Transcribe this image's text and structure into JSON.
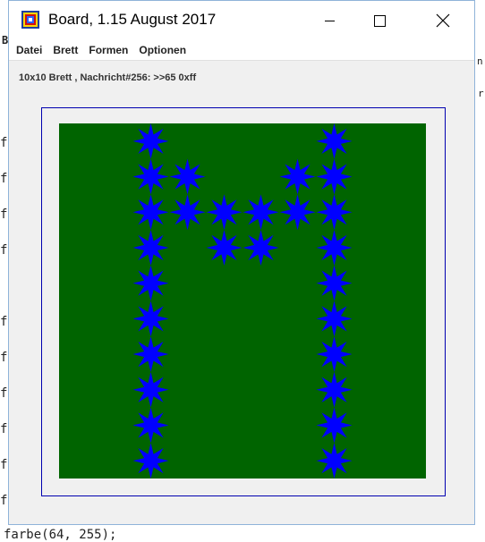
{
  "window": {
    "title": "Board, 1.15 August 2017",
    "minimize_icon": "minimize-icon",
    "maximize_icon": "maximize-icon",
    "close_icon": "close-icon"
  },
  "menu": [
    "Datei",
    "Brett",
    "Formen",
    "Optionen"
  ],
  "status": "10x10 Brett , Nachricht#256: >>65 0xff",
  "background": {
    "left_chars": [
      "B",
      "f",
      "f",
      "f",
      "f",
      "f",
      "f",
      "f",
      "f",
      "f",
      "f"
    ],
    "right_chars": [
      "n",
      "r"
    ],
    "bottom_text": "farbe(64, 255);"
  },
  "board": {
    "size": 10,
    "background_color": "#006400",
    "star_color": "#0000ff",
    "star_icon": "star-icon",
    "stars": [
      [
        2,
        0
      ],
      [
        7,
        0
      ],
      [
        2,
        1
      ],
      [
        3,
        1
      ],
      [
        6,
        1
      ],
      [
        7,
        1
      ],
      [
        2,
        2
      ],
      [
        3,
        2
      ],
      [
        4,
        2
      ],
      [
        5,
        2
      ],
      [
        6,
        2
      ],
      [
        7,
        2
      ],
      [
        2,
        3
      ],
      [
        4,
        3
      ],
      [
        5,
        3
      ],
      [
        7,
        3
      ],
      [
        2,
        4
      ],
      [
        7,
        4
      ],
      [
        2,
        5
      ],
      [
        7,
        5
      ],
      [
        2,
        6
      ],
      [
        7,
        6
      ],
      [
        2,
        7
      ],
      [
        7,
        7
      ],
      [
        2,
        8
      ],
      [
        7,
        8
      ],
      [
        2,
        9
      ],
      [
        7,
        9
      ]
    ]
  }
}
